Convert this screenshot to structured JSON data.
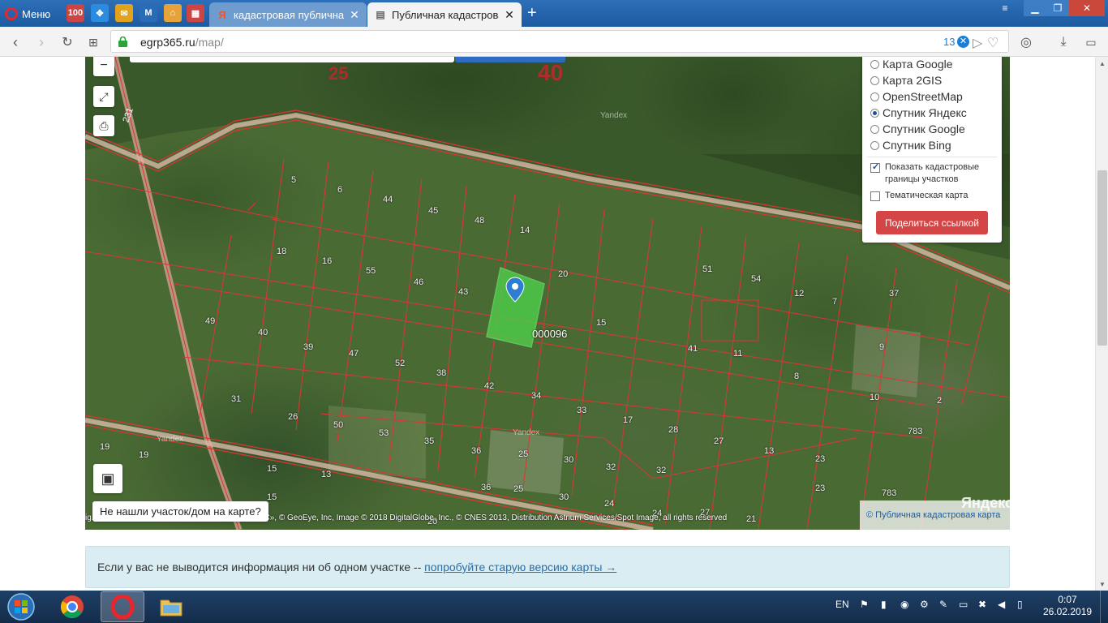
{
  "browser": {
    "menu_label": "Меню",
    "tabs": [
      {
        "title": "кадастровая публичная к",
        "active": false,
        "favicon": "yandex-icon"
      },
      {
        "title": "Публичная кадастровая к",
        "active": true,
        "favicon": "document-icon"
      }
    ],
    "pinned": [
      {
        "name": "100-icon",
        "text": "100"
      },
      {
        "name": "dropbox-icon",
        "text": ""
      },
      {
        "name": "mail-icon",
        "text": ""
      },
      {
        "name": "m-icon",
        "text": "M"
      },
      {
        "name": "home-icon",
        "text": ""
      },
      {
        "name": "grid-icon",
        "text": ""
      }
    ],
    "url_domain": "egrp365.ru",
    "url_path": "/map/",
    "ad_block_count": "13"
  },
  "map": {
    "top_labels": [
      "25",
      "40"
    ],
    "layers": [
      {
        "label": "Карта Google",
        "selected": false
      },
      {
        "label": "Карта 2GIS",
        "selected": false
      },
      {
        "label": "OpenStreetMap",
        "selected": false
      },
      {
        "label": "Спутник Яндекс",
        "selected": true
      },
      {
        "label": "Спутник Google",
        "selected": false
      },
      {
        "label": "Спутник Bing",
        "selected": false
      }
    ],
    "show_cadastral_label": "Показать кадастровые границы участков",
    "show_cadastral_checked": true,
    "thematic_label": "Тематическая карта",
    "thematic_checked": false,
    "share_button": "Поделиться ссылкой",
    "not_found_label": "Не нашли участок/дом на карте?",
    "copyright": "ig... DS, распространяется ООО ИТЦ «СКАНЭКС», © GeoEye, Inc, Image © 2018 DigitalGlobe, Inc., © CNES 2013, Distribution Astrium Services/Spot Image, all rights reserved",
    "cadastral_link": "© Публичная кадастровая карта",
    "yandex_logo": "Яндекс",
    "watermark": "Yandex",
    "highlighted_parcel": "000096",
    "road_label": "231",
    "parcels": [
      "5",
      "6",
      "44",
      "45",
      "48",
      "14",
      "18",
      "16",
      "55",
      "46",
      "43",
      "20",
      "51",
      "54",
      "12",
      "7",
      "37",
      "49",
      "40",
      "39",
      "47",
      "52",
      "38",
      "42",
      "15",
      "41",
      "11",
      "8",
      "9",
      "10",
      "31",
      "26",
      "50",
      "53",
      "35",
      "36",
      "25",
      "34",
      "33",
      "17",
      "28",
      "27",
      "13",
      "23",
      "783",
      "2",
      "19",
      "19",
      "15",
      "13",
      "15",
      "36",
      "25",
      "30",
      "30",
      "32",
      "24",
      "32",
      "24",
      "27",
      "23",
      "21",
      "783",
      "20"
    ]
  },
  "info": {
    "text": "Если у вас не выводится информация ни об одном участке -- ",
    "link": "попробуйте старую версию карты →"
  },
  "taskbar": {
    "lang": "EN",
    "time": "0:07",
    "date": "26.02.2019"
  },
  "colors": {
    "parcel_border": "#e03434",
    "highlight_fill": "#4cd64c",
    "share_button": "#d64545",
    "info_bg": "#d9edf3"
  }
}
